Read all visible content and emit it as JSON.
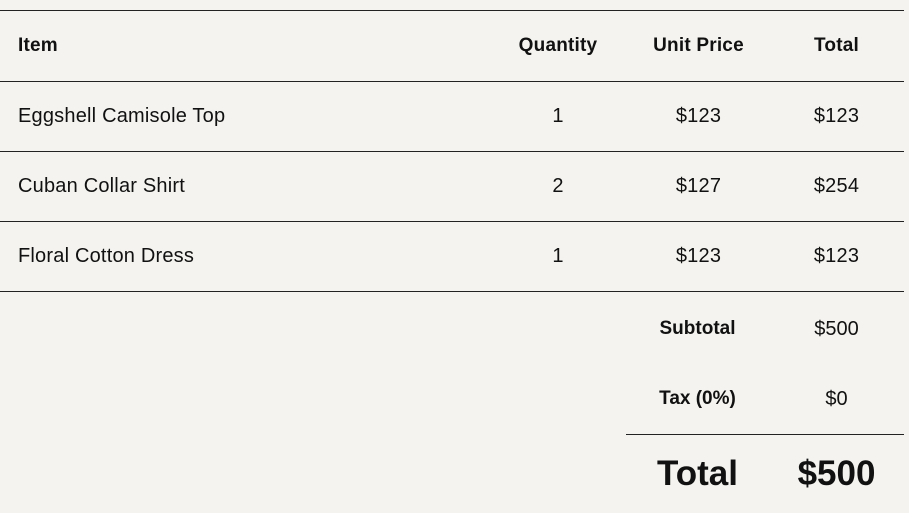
{
  "table": {
    "headers": {
      "item": "Item",
      "quantity": "Quantity",
      "unit_price": "Unit Price",
      "total": "Total"
    },
    "rows": [
      {
        "item": "Eggshell Camisole Top",
        "quantity": "1",
        "unit_price": "$123",
        "total": "$123"
      },
      {
        "item": "Cuban Collar Shirt",
        "quantity": "2",
        "unit_price": "$127",
        "total": "$254"
      },
      {
        "item": "Floral Cotton Dress",
        "quantity": "1",
        "unit_price": "$123",
        "total": "$123"
      }
    ]
  },
  "summary": {
    "subtotal_label": "Subtotal",
    "subtotal_value": "$500",
    "tax_label": "Tax (0%)",
    "tax_value": "$0",
    "grand_total_label": "Total",
    "grand_total_value": "$500"
  },
  "colors": {
    "background": "#f4f3ef",
    "text": "#111111",
    "rule": "#222222"
  }
}
